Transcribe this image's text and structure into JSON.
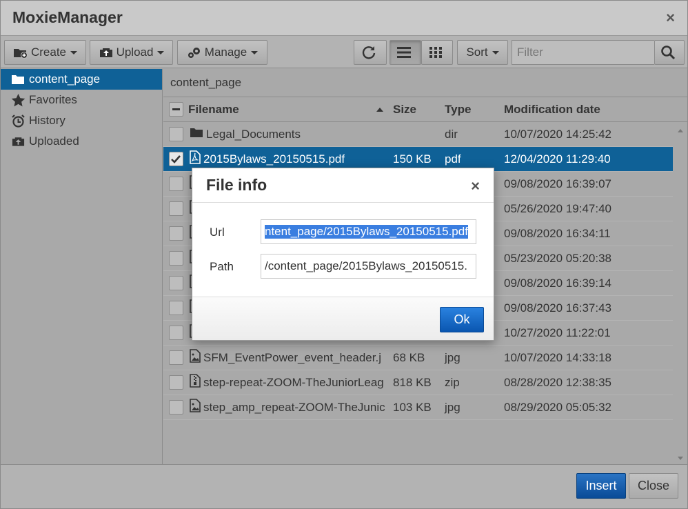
{
  "window": {
    "title": "MoxieManager",
    "close_glyph": "×"
  },
  "toolbar": {
    "create_label": "Create",
    "upload_label": "Upload",
    "manage_label": "Manage",
    "sort_label": "Sort",
    "filter_placeholder": "Filter"
  },
  "sidebar": {
    "items": [
      {
        "label": "content_page",
        "icon": "folder-open-icon",
        "active": true
      },
      {
        "label": "Favorites",
        "icon": "star-icon"
      },
      {
        "label": "History",
        "icon": "alarm-clock-icon"
      },
      {
        "label": "Uploaded",
        "icon": "upload-box-icon"
      }
    ]
  },
  "main": {
    "path": "content_page",
    "columns": {
      "filename": "Filename",
      "size": "Size",
      "type": "Type",
      "date": "Modification date"
    },
    "rows": [
      {
        "name": "Legal_Documents",
        "size": "",
        "type": "dir",
        "date": "10/07/2020 14:25:42",
        "icon": "folder-icon"
      },
      {
        "name": "2015Bylaws_20150515.pdf",
        "size": "150 KB",
        "type": "pdf",
        "date": "12/04/2020 11:29:40",
        "icon": "pdf-icon",
        "selected": true
      },
      {
        "name": "",
        "size": "",
        "type": "",
        "date": "09/08/2020 16:39:07",
        "icon": "file-icon"
      },
      {
        "name": "",
        "size": "",
        "type": "",
        "date": "05/26/2020 19:47:40",
        "icon": "file-icon"
      },
      {
        "name": "",
        "size": "",
        "type": "",
        "date": "09/08/2020 16:34:11",
        "icon": "file-icon"
      },
      {
        "name": "",
        "size": "",
        "type": "",
        "date": "05/23/2020 05:20:38",
        "icon": "file-icon"
      },
      {
        "name": "",
        "size": "",
        "type": "",
        "date": "09/08/2020 16:39:14",
        "icon": "file-icon"
      },
      {
        "name": "",
        "size": "",
        "type": "",
        "date": "09/08/2020 16:37:43",
        "icon": "file-icon"
      },
      {
        "name": "",
        "size": "",
        "type": "",
        "date": "10/27/2020 11:22:01",
        "icon": "file-icon"
      },
      {
        "name": "SFM_EventPower_event_header.j",
        "size": "68 KB",
        "type": "jpg",
        "date": "10/07/2020 14:33:18",
        "icon": "image-icon"
      },
      {
        "name": "step-repeat-ZOOM-TheJuniorLeag",
        "size": "818 KB",
        "type": "zip",
        "date": "08/28/2020 12:38:35",
        "icon": "zip-icon"
      },
      {
        "name": "step_amp_repeat-ZOOM-TheJunic",
        "size": "103 KB",
        "type": "jpg",
        "date": "08/29/2020 05:05:32",
        "icon": "image-icon"
      }
    ]
  },
  "footer": {
    "insert_label": "Insert",
    "close_label": "Close"
  },
  "dialog": {
    "title": "File info",
    "close_glyph": "×",
    "url_label": "Url",
    "url_value": "ntent_page/2015Bylaws_20150515.pdf",
    "path_label": "Path",
    "path_value": "/content_page/2015Bylaws_20150515.",
    "ok_label": "Ok"
  },
  "colors": {
    "selection": "#0f6197",
    "primary_button": "#0a56b0"
  }
}
